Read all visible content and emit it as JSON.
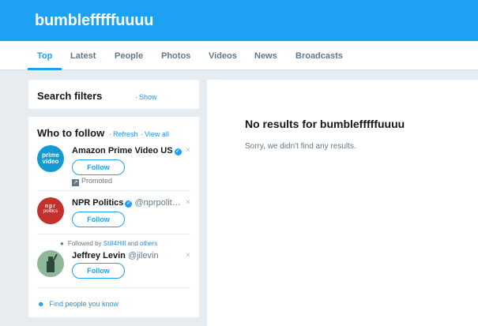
{
  "header": {
    "title": "bumblefffffuuuu"
  },
  "tabs": [
    {
      "label": "Top",
      "active": true
    },
    {
      "label": "Latest"
    },
    {
      "label": "People"
    },
    {
      "label": "Photos"
    },
    {
      "label": "Videos"
    },
    {
      "label": "News"
    },
    {
      "label": "Broadcasts"
    }
  ],
  "search_filters": {
    "title": "Search filters",
    "separator": "·",
    "show_label": "Show"
  },
  "who_to_follow": {
    "title": "Who to follow",
    "refresh_label": "Refresh",
    "view_all_label": "View all",
    "separator": "·",
    "accounts": [
      {
        "name": "Amazon Prime Video US",
        "handle": "",
        "verified": true,
        "follow_label": "Follow",
        "promoted_label": "Promoted",
        "avatar_text": "prime video"
      },
      {
        "name": "NPR Politics",
        "handle": "@nprpolit…",
        "verified": true,
        "follow_label": "Follow",
        "avatar_text_top": "npr",
        "avatar_text_bottom": "politics"
      },
      {
        "name": "Jeffrey Levin",
        "handle": "@jilevin",
        "verified": false,
        "follow_label": "Follow",
        "context_prefix": "Followed by",
        "context_user": "Still4Hill",
        "context_and": "and",
        "context_others": "others"
      }
    ],
    "find_people_label": "Find people you know"
  },
  "results": {
    "heading": "No results for bumblefffffuuuu",
    "message": "Sorry, we didn't find any results."
  },
  "colors": {
    "brand": "#1da1f2",
    "link": "#1b95e0",
    "background": "#e6ecf0",
    "muted": "#657786"
  },
  "icons": {
    "verified": "verified-badge-icon",
    "close": "close-icon",
    "promoted": "promoted-icon",
    "follower": "person-icon",
    "find": "people-icon"
  }
}
